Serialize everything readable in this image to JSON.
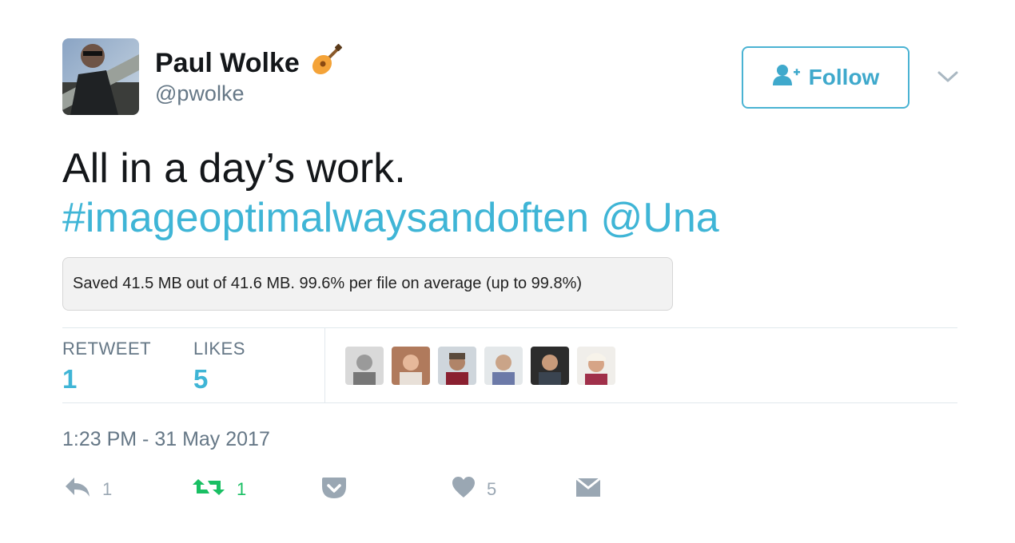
{
  "tweet": {
    "author": {
      "display_name": "Paul Wolke",
      "handle": "@pwolke",
      "badge_icon": "guitar-icon"
    },
    "follow_button": {
      "label": "Follow",
      "icon": "add-user-icon"
    },
    "menu_icon": "chevron-down-icon",
    "text_line1": "All in a day’s work.",
    "hashtag": "#imageoptimalwaysandoften",
    "mention": "@Una",
    "image_note": "Saved 41.5 MB out of 41.6 MB. 99.6% per file on average (up to 99.8%)",
    "stats": {
      "retweets_label": "RETWEET",
      "retweets_value": "1",
      "likes_label": "LIKES",
      "likes_value": "5",
      "likers_count": 6
    },
    "timestamp": "1:23 PM - 31 May 2017",
    "actions": {
      "reply_count": "1",
      "retweet_count": "1",
      "like_count": "5",
      "icons": [
        "reply-icon",
        "retweet-icon",
        "pocket-icon",
        "heart-icon",
        "message-icon"
      ]
    },
    "colors": {
      "link": "#3fb5d6",
      "retweet_active": "#19bf63",
      "muted": "#657786",
      "action_gray": "#9aa7b3"
    }
  }
}
